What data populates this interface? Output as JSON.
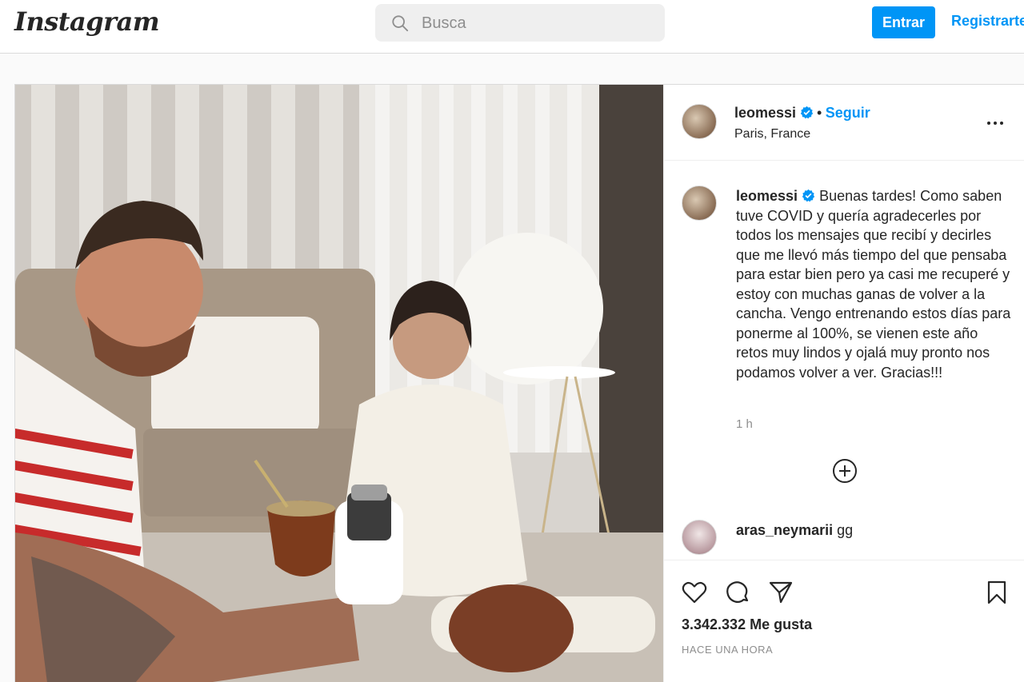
{
  "nav": {
    "logo": "Instagram",
    "search_placeholder": "Busca",
    "login_label": "Entrar",
    "register_label": "Registrarte"
  },
  "post": {
    "username": "leomessi",
    "verified_icon": "verified-badge-icon",
    "separator": "•",
    "follow_label": "Seguir",
    "location": "Paris, France",
    "caption": "Buenas tardes! Como saben tuve COVID y quería agradecerles por todos los mensajes que recibí y decirles que me llevó más tiempo del que pensaba para estar bien pero ya casi me recuperé y estoy con muchas ganas de volver a la cancha. Vengo entrenando estos días para ponerme al 100%, se vienen este año retos muy lindos y ojalá muy pronto nos podamos volver a ver. Gracias!!!",
    "caption_time": "1 h",
    "likes": "3.342.332 Me gusta",
    "posted_time": "HACE UNA HORA"
  },
  "comments": [
    {
      "username": "aras_neymarii",
      "text": "gg"
    }
  ],
  "colors": {
    "accent": "#0095f6",
    "text": "#262626",
    "muted": "#8e8e8e",
    "border": "#dbdbdb"
  }
}
